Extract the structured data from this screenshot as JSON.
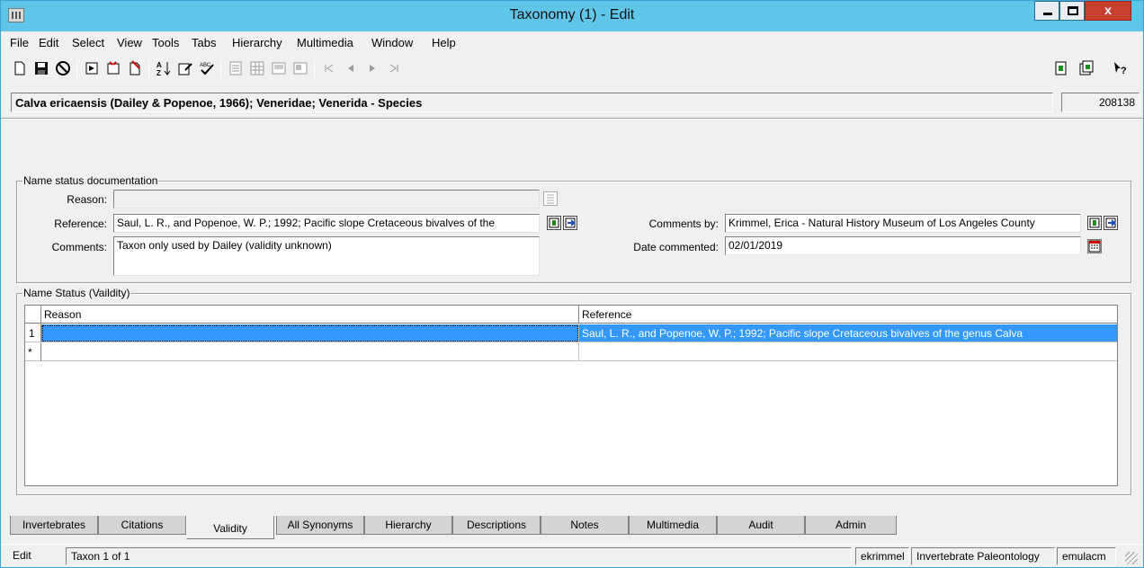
{
  "window": {
    "title": "Taxonomy (1) - Edit",
    "close_glyph": "x"
  },
  "menu": [
    "File",
    "Edit",
    "Select",
    "View",
    "Tools",
    "Tabs",
    "Hierarchy",
    "Multimedia",
    "Window",
    "Help"
  ],
  "toolbar_icons": [
    "new-icon",
    "save-icon",
    "cancel-icon",
    "attach-icon",
    "detach-icon",
    "discard-icon",
    "sort-icon",
    "edit-icon",
    "spell-icon",
    "page-icon",
    "list-icon",
    "image-icon",
    "report-icon",
    "first-icon",
    "prev-icon",
    "next-icon",
    "last-icon",
    "copy-icon",
    "paste-icon",
    "help-icon"
  ],
  "summary": {
    "text": "Calva ericaensis (Dailey & Popenoe, 1966); Veneridae; Venerida - Species",
    "irn": "208138"
  },
  "documentation": {
    "group_label": "Name status documentation",
    "reason_label": "Reason:",
    "reason_value": "",
    "reference_label": "Reference:",
    "reference_value": "Saul, L. R., and Popenoe, W. P.; 1992; Pacific slope Cretaceous bivalves of the",
    "comments_label": "Comments:",
    "comments_value": "Taxon only used by Dailey (validity unknown)",
    "comments_by_label": "Comments by:",
    "comments_by_value": "Krimmel, Erica - Natural History Museum of Los Angeles County",
    "date_label": "Date commented:",
    "date_value": "02/01/2019"
  },
  "validity": {
    "group_label": "Name Status (Vaildity)",
    "columns": [
      "Reason",
      "Reference"
    ],
    "rows": [
      {
        "num": "1",
        "reason": "",
        "reference": "Saul, L. R., and Popenoe, W. P.; 1992; Pacific slope Cretaceous bivalves of the genus Calva"
      }
    ],
    "new_row_marker": "*"
  },
  "tabs": [
    "Invertebrates",
    "Citations",
    "Validity",
    "All Synonyms",
    "Hierarchy",
    "Descriptions",
    "Notes",
    "Multimedia",
    "Audit",
    "Admin"
  ],
  "active_tab": "Validity",
  "status": {
    "mode": "Edit",
    "record": "Taxon 1 of 1",
    "user": "ekrimmel",
    "department": "Invertebrate Paleontology",
    "host": "emulacm"
  },
  "colors": {
    "titlebar": "#5fc6ea",
    "selection": "#3399ff",
    "close": "#c7402e"
  }
}
